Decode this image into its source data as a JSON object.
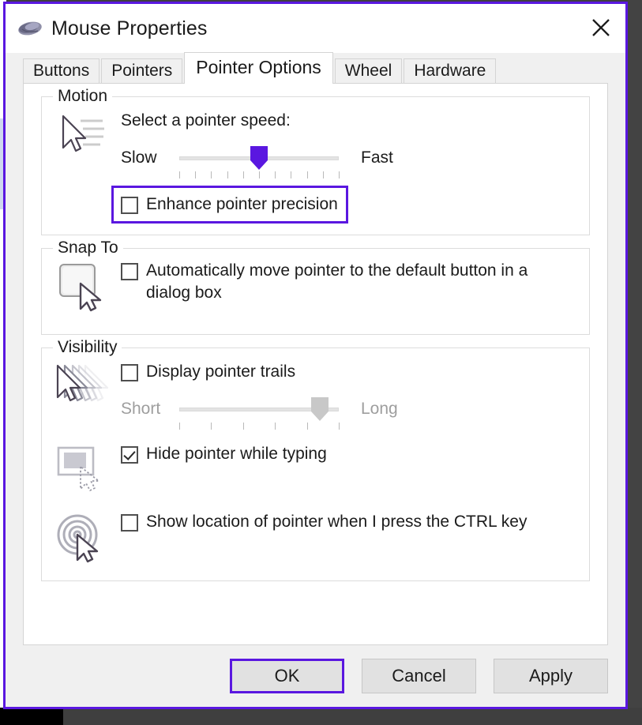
{
  "window": {
    "title": "Mouse Properties",
    "icon": "mouse-icon",
    "close_label": "✕",
    "border_color": "#5a17e0"
  },
  "tabs": [
    {
      "label": "Buttons",
      "active": false
    },
    {
      "label": "Pointers",
      "active": false
    },
    {
      "label": "Pointer Options",
      "active": true
    },
    {
      "label": "Wheel",
      "active": false
    },
    {
      "label": "Hardware",
      "active": false
    }
  ],
  "groups": {
    "motion": {
      "legend": "Motion",
      "icon": "pointer-speed-icon",
      "caption": "Select a pointer speed:",
      "slider": {
        "left_label": "Slow",
        "right_label": "Fast",
        "value": 50,
        "min": 0,
        "max": 100,
        "ticks": 11,
        "enabled": true,
        "thumb_color": "#5a17e0"
      },
      "checkbox": {
        "label": "Enhance pointer precision",
        "checked": false,
        "focused": true
      }
    },
    "snap_to": {
      "legend": "Snap To",
      "icon": "default-button-pointer-icon",
      "checkbox": {
        "label": "Automatically move pointer to the default button in a dialog box",
        "checked": false,
        "focused": false
      }
    },
    "visibility": {
      "legend": "Visibility",
      "trails": {
        "icon": "pointer-trails-icon",
        "checkbox": {
          "label": "Display pointer trails",
          "checked": false
        },
        "slider": {
          "left_label": "Short",
          "right_label": "Long",
          "value": 88,
          "min": 0,
          "max": 100,
          "ticks": 6,
          "enabled": false,
          "thumb_color": "#c8c8c8"
        }
      },
      "hide_typing": {
        "icon": "hide-pointer-typing-icon",
        "checkbox": {
          "label": "Hide pointer while typing",
          "checked": true
        }
      },
      "ctrl_locate": {
        "icon": "pointer-location-ctrl-icon",
        "checkbox": {
          "label": "Show location of pointer when I press the CTRL key",
          "checked": false
        }
      }
    }
  },
  "footer": {
    "ok_label": "OK",
    "cancel_label": "Cancel",
    "apply_label": "Apply",
    "default_button": "OK"
  }
}
